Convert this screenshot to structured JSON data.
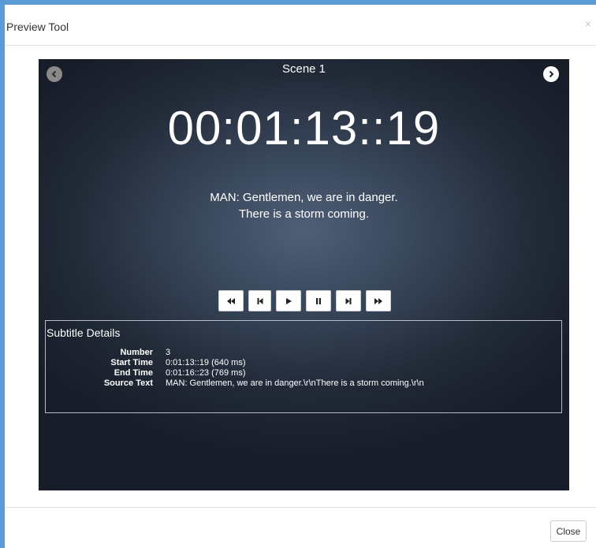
{
  "modal": {
    "title": "Preview Tool",
    "close_symbol": "×"
  },
  "stage": {
    "scene_title": "Scene 1",
    "timecode": "00:01:13::19",
    "subtitle_lines": [
      "MAN: Gentlemen, we are in danger.",
      "There is a storm coming."
    ],
    "nav_icons": [
      "chevron-left-icon",
      "chevron-right-icon"
    ]
  },
  "controls": {
    "icons": [
      "fast-rewind-icon",
      "skip-previous-icon",
      "play-icon",
      "pause-icon",
      "skip-next-icon",
      "fast-forward-icon"
    ]
  },
  "details": {
    "title": "Subtitle Details",
    "rows": [
      {
        "label": "Number",
        "value": "3"
      },
      {
        "label": "Start Time",
        "value": "0:01:13::19 (640 ms)"
      },
      {
        "label": "End Time",
        "value": "0:01:16::23 (769 ms)"
      },
      {
        "label": "Source Text",
        "value": "MAN: Gentlemen, we are in danger.\\r\\nThere is a storm coming.\\r\\n"
      }
    ]
  },
  "footer": {
    "close_label": "Close"
  },
  "colors": {
    "frame_accent": "#5b9bd5",
    "stage_center": "#4f5f77",
    "stage_edge": "#181e29"
  }
}
